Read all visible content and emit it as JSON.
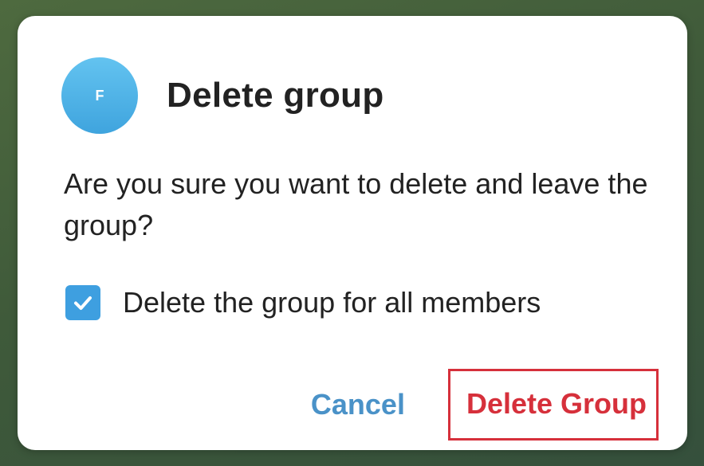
{
  "dialog": {
    "avatar_initial": "F",
    "title": "Delete group",
    "message": "Are you sure you want to delete and leave the group?",
    "checkbox": {
      "label": "Delete the group for all members",
      "checked": true
    },
    "buttons": {
      "cancel": "Cancel",
      "confirm": "Delete Group"
    }
  },
  "colors": {
    "accent": "#3e9fe0",
    "cancel_text": "#4a92c8",
    "destructive": "#d6303b",
    "highlight_border": "#d6303b"
  },
  "icons": {
    "checkbox": "checkmark-icon"
  }
}
